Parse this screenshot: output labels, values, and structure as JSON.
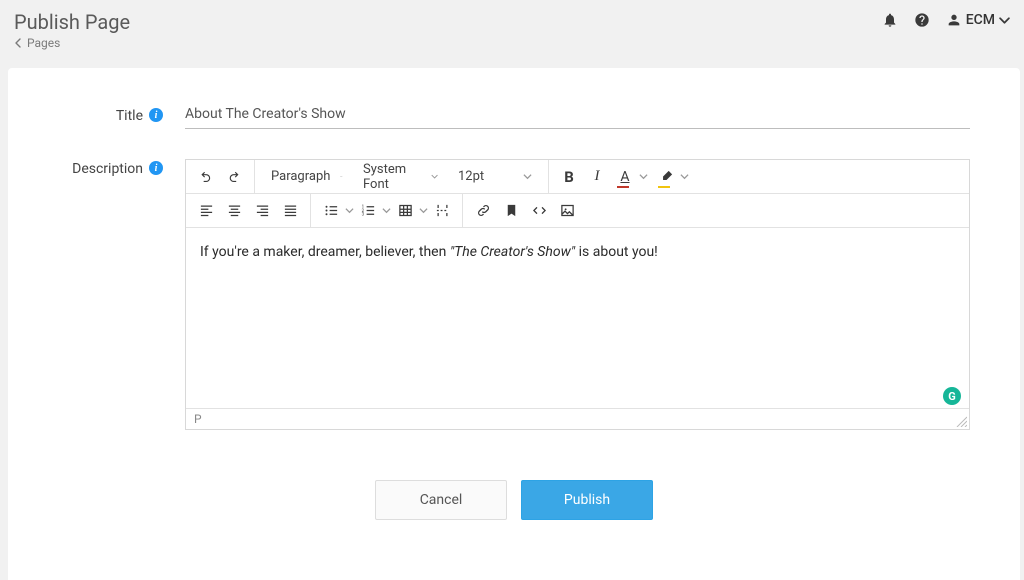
{
  "header": {
    "title": "Publish Page",
    "breadcrumb_back": "Pages",
    "user_label": "ECM"
  },
  "form": {
    "title_label": "Title",
    "title_value": "About The Creator's Show",
    "description_label": "Description",
    "editor": {
      "block_select": "Paragraph",
      "font_select": "System Font",
      "size_select": "12pt",
      "content_pre": "If you're a maker, dreamer, believer, then ",
      "content_em": "\"The Creator's Show\"",
      "content_post": " is about you!",
      "path": "P",
      "text_color": "#c0392b",
      "highlight_color": "#f1c40f"
    },
    "grammarly_badge": "G"
  },
  "actions": {
    "cancel": "Cancel",
    "publish": "Publish"
  }
}
